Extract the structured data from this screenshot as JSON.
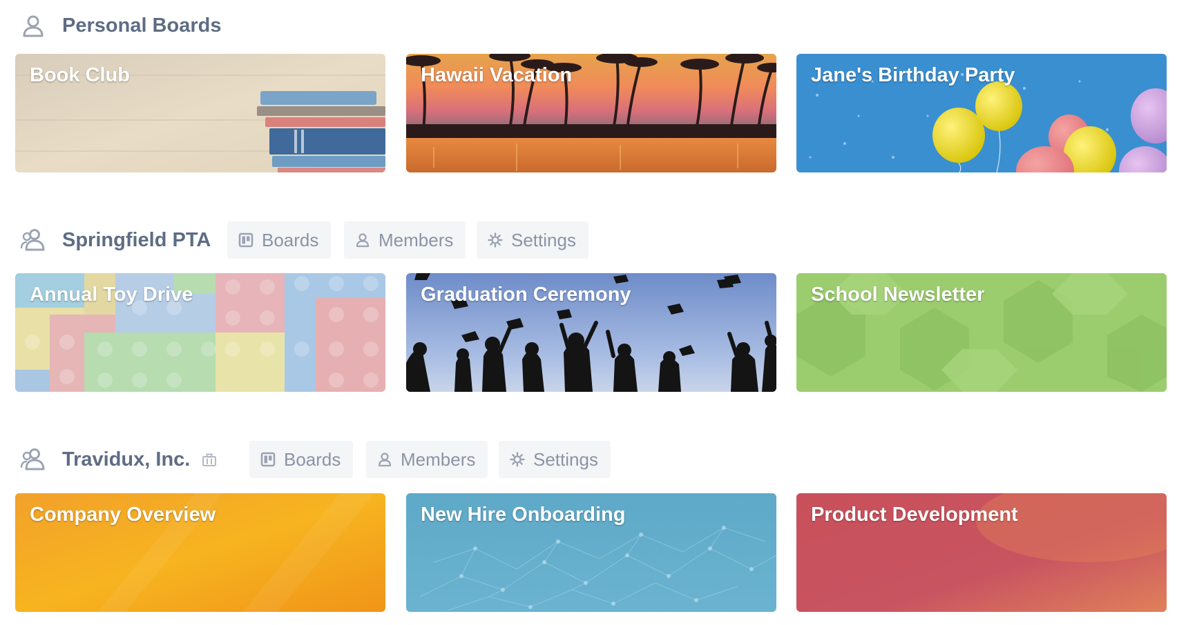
{
  "sections": [
    {
      "title": "Personal Boards",
      "icon": "person-icon",
      "boards": [
        {
          "title": "Book Club",
          "background": "wood-books"
        },
        {
          "title": "Hawaii Vacation",
          "background": "sunset-palms"
        },
        {
          "title": "Jane's Birthday Party",
          "background": "balloons-blue"
        }
      ]
    },
    {
      "title": "Springfield PTA",
      "icon": "team-icon",
      "tabs": [
        {
          "label": "Boards",
          "icon": "board-icon"
        },
        {
          "label": "Members",
          "icon": "person-icon"
        },
        {
          "label": "Settings",
          "icon": "gear-icon"
        }
      ],
      "boards": [
        {
          "title": "Annual Toy Drive",
          "background": "toy-bricks"
        },
        {
          "title": "Graduation Ceremony",
          "background": "graduation-caps"
        },
        {
          "title": "School Newsletter",
          "background": "green-hexagons"
        }
      ]
    },
    {
      "title": "Travidux, Inc.",
      "icon": "team-icon",
      "badge_icon": "business-briefcase-icon",
      "tabs": [
        {
          "label": "Boards",
          "icon": "board-icon"
        },
        {
          "label": "Members",
          "icon": "person-icon"
        },
        {
          "label": "Settings",
          "icon": "gear-icon"
        }
      ],
      "boards": [
        {
          "title": "Company Overview",
          "background": "orange-gradient"
        },
        {
          "title": "New Hire Onboarding",
          "background": "blue-network"
        },
        {
          "title": "Product Development",
          "background": "red-gradient"
        }
      ]
    }
  ],
  "colors": {
    "heading": "#5e6c84",
    "pill_bg": "#f4f5f7",
    "pill_text": "#8a94a6",
    "tile_text": "#ffffff"
  }
}
